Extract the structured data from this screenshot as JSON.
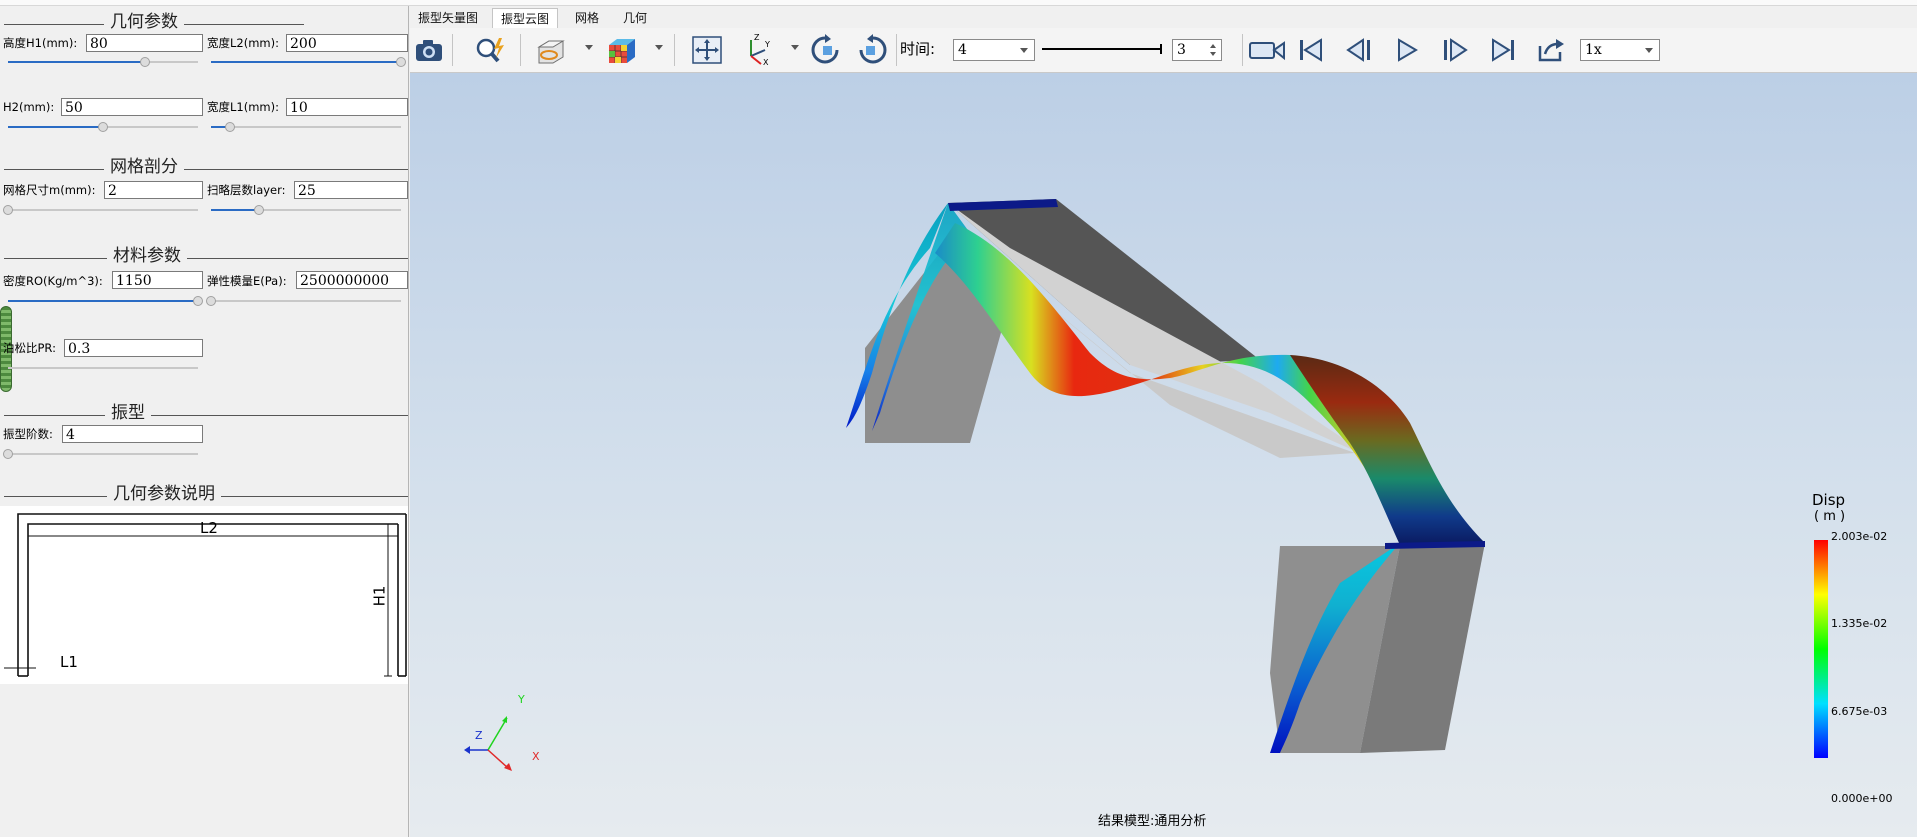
{
  "left_panel": {
    "geometry_group": {
      "title": "几何参数",
      "h1_label": "高度H1(mm):",
      "h1_value": "80",
      "h1_fraction": 0.72,
      "l2_label": "宽度L2(mm):",
      "l2_value": "200",
      "l2_fraction": 1.0,
      "h2_label": "H2(mm):",
      "h2_value": "50",
      "h2_fraction": 0.5,
      "l1_label": "宽度L1(mm):",
      "l1_value": "10",
      "l1_fraction": 0.1
    },
    "mesh_group": {
      "title": "网格剖分",
      "size_label": "网格尺寸m(mm):",
      "size_value": "2",
      "size_fraction": 0.0,
      "layer_label": "扫略层数layer:",
      "layer_value": "25",
      "layer_fraction": 0.25
    },
    "material_group": {
      "title": "材料参数",
      "density_label": "密度RO(Kg/m^3):",
      "density_value": "1150",
      "density_fraction": 1.0,
      "modulus_label": "弹性模量E(Pa):",
      "modulus_value": "2500000000",
      "modulus_fraction": 0.0,
      "poisson_label": "泊松比PR:",
      "poisson_value": "0.3"
    },
    "mode_group": {
      "title": "振型",
      "order_label": "振型阶数:",
      "order_value": "4",
      "order_fraction": 0.0
    },
    "diagram_group": {
      "title": "几何参数说明",
      "labels": {
        "l2": "L2",
        "h1": "H1",
        "l1": "L1"
      }
    }
  },
  "tabs": [
    {
      "label": "振型矢量图",
      "active": false
    },
    {
      "label": "振型云图",
      "active": true
    },
    {
      "label": "网格",
      "active": false
    },
    {
      "label": "几何",
      "active": false
    }
  ],
  "toolbar": {
    "icons": [
      "camera-icon",
      "zoom-query-icon",
      "display-mode-icon",
      "mesh-color-icon",
      "fit-view-icon",
      "axis-view-icon",
      "rotate-cw-icon",
      "rotate-ccw-icon"
    ],
    "time_label": "时间:",
    "time_value": "4",
    "frame_value": "3",
    "playback_icons": [
      "record-video-icon",
      "first-frame-icon",
      "prev-frame-icon",
      "play-icon",
      "next-frame-icon",
      "last-frame-icon",
      "export-icon"
    ],
    "speed_value": "1x"
  },
  "viewport": {
    "legend": {
      "title": "Disp",
      "unit": "( m )",
      "ticks": [
        "2.003e-02",
        "1.335e-02",
        "6.675e-03",
        "0.000e+00"
      ]
    },
    "axes": {
      "x": "X",
      "y": "Y",
      "z": "Z"
    },
    "caption": "结果模型:通用分析"
  }
}
